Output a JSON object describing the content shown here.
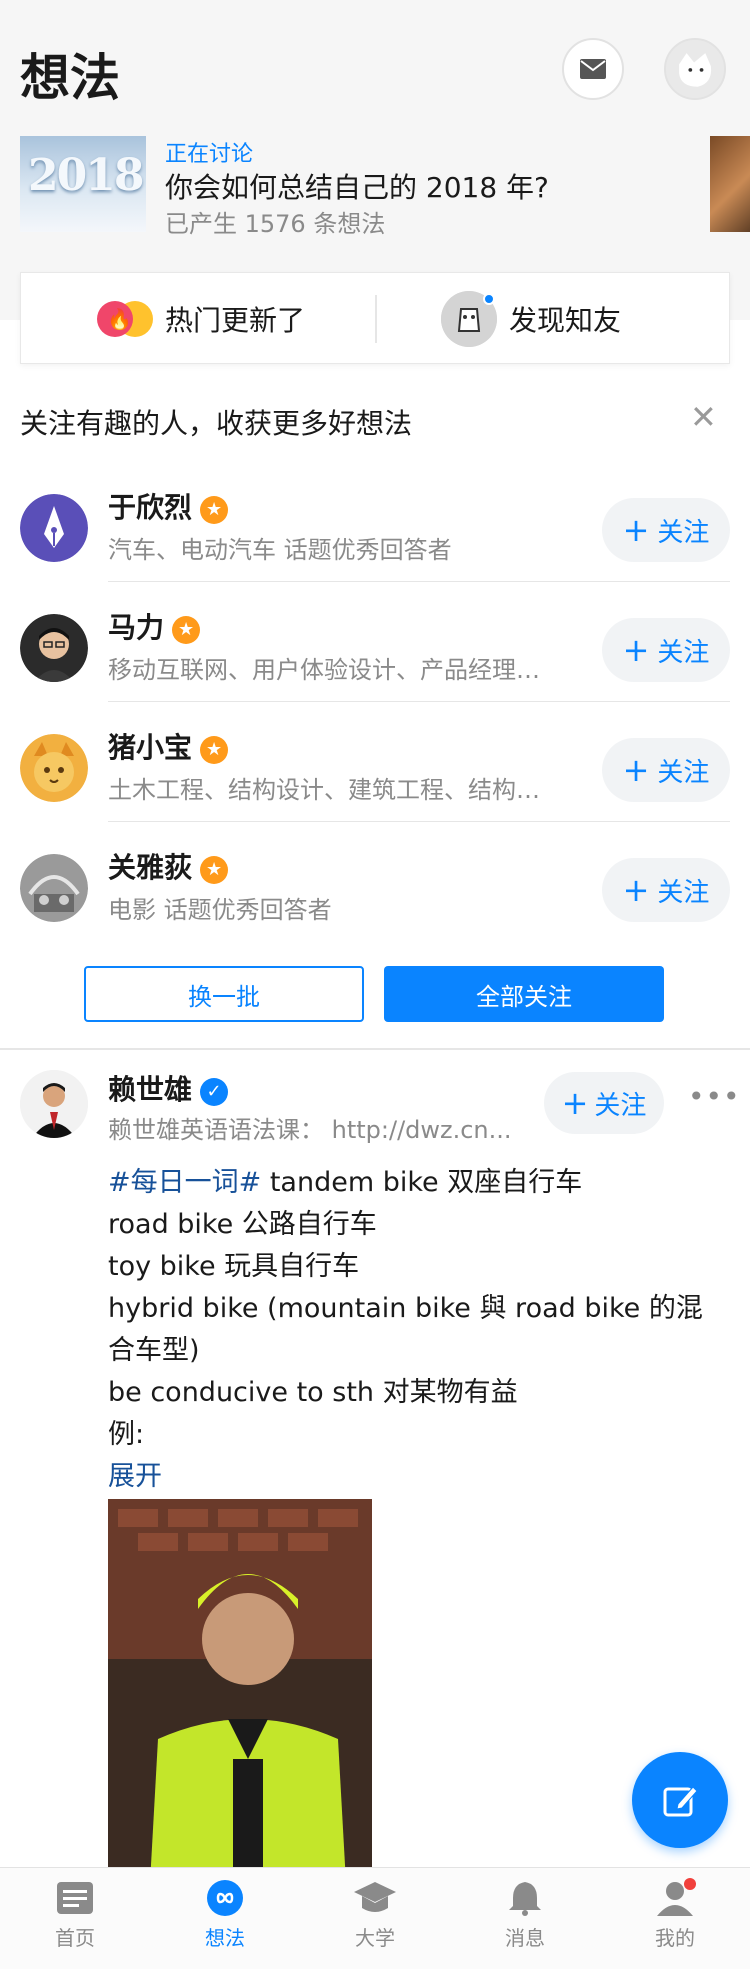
{
  "header": {
    "title": "想法",
    "mail_icon": "mail-icon",
    "avatar_icon": "user-avatar"
  },
  "topic": {
    "image_text": "2018",
    "tag": "正在讨论",
    "title": "你会如何总结自己的 2018 年?",
    "count": "已产生 1576 条想法"
  },
  "quick": {
    "hot_label": "热门更新了",
    "friends_label": "发现知友"
  },
  "recommend": {
    "title": "关注有趣的人，收获更多好想法",
    "close_icon": "close-icon",
    "follow_label": "关注",
    "users": [
      {
        "name": "于欣烈",
        "desc": "汽车、电动汽车 话题优秀回答者",
        "badge": "orange"
      },
      {
        "name": "马力",
        "desc": "移动互联网、用户体验设计、产品经理…",
        "badge": "orange-blue"
      },
      {
        "name": "猪小宝",
        "desc": "土木工程、结构设计、建筑工程、结构…",
        "badge": "orange"
      },
      {
        "name": "关雅荻",
        "desc": "电影 话题优秀回答者",
        "badge": "orange"
      }
    ],
    "batch_label": "换一批",
    "follow_all_label": "全部关注"
  },
  "post": {
    "author": "赖世雄",
    "sub": "赖世雄英语语法课： http://dwz.cn...",
    "follow_label": "关注",
    "tag": "#每日一词#",
    "lines": [
      " tandem bike 双座自行车",
      "road bike 公路自行车",
      "toy bike 玩具自行车",
      "hybrid bike (mountain bike 與 road bike 的混合车型)",
      "be conducive to sth 对某物有益",
      "例:"
    ],
    "expand": "展开"
  },
  "tabs": [
    {
      "label": "首页",
      "icon": "home-icon"
    },
    {
      "label": "想法",
      "icon": "thoughts-icon"
    },
    {
      "label": "大学",
      "icon": "university-icon"
    },
    {
      "label": "消息",
      "icon": "bell-icon"
    },
    {
      "label": "我的",
      "icon": "profile-icon"
    }
  ],
  "colors": {
    "accent": "#0a84ff",
    "link": "#175199",
    "badge_orange": "#ff9a1a",
    "notification_dot": "#f1403c"
  }
}
